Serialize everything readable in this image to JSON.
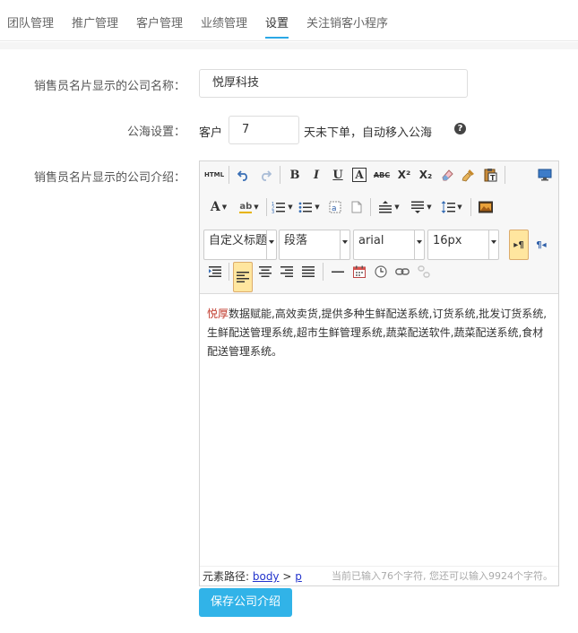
{
  "tabs": [
    {
      "label": "团队管理"
    },
    {
      "label": "推广管理"
    },
    {
      "label": "客户管理"
    },
    {
      "label": "业绩管理"
    },
    {
      "label": "设置"
    },
    {
      "label": "关注销客小程序"
    }
  ],
  "active_tab": "设置",
  "form": {
    "company_name_label": "销售员名片显示的公司名称：",
    "company_name_value": "悦厚科技",
    "pool_label": "公海设置：",
    "pool_prefix": "客户",
    "pool_days": "7",
    "pool_suffix": "天未下单，自动移入公海",
    "help_icon": "?",
    "intro_label": "销售员名片显示的公司介绍："
  },
  "editor": {
    "toolbar": {
      "html_label": "HTML",
      "bold": "B",
      "italic": "I",
      "underline": "U",
      "border_letter": "A",
      "strike": "ABC",
      "superscript": "X²",
      "subscript": "X₂",
      "font_color": "A",
      "highlight": "ab",
      "paragraph_combo": "自定义标题",
      "heading_combo": "段落",
      "font_family_combo": "arial",
      "font_size_combo": "16px",
      "ltr_icon": "▸¶",
      "rtl_icon": "¶◂"
    },
    "content_brand": "悦厚",
    "content_text": "数据赋能,高效卖货,提供多种生鲜配送系统,订货系统,批发订货系统,生鲜配送管理系统,超市生鲜管理系统,蔬菜配送软件,蔬菜配送系统,食材配送管理系统。",
    "path_label": "元素路径: ",
    "path_body": "body",
    "path_sep": " > ",
    "path_p": "p",
    "word_count": "当前已输入76个字符, 您还可以输入9924个字符。"
  },
  "save_button": "保存公司介绍",
  "colors": {
    "accent": "#2ba8e6",
    "save_button": "#31b3e8",
    "brand_text": "#c0392b"
  }
}
